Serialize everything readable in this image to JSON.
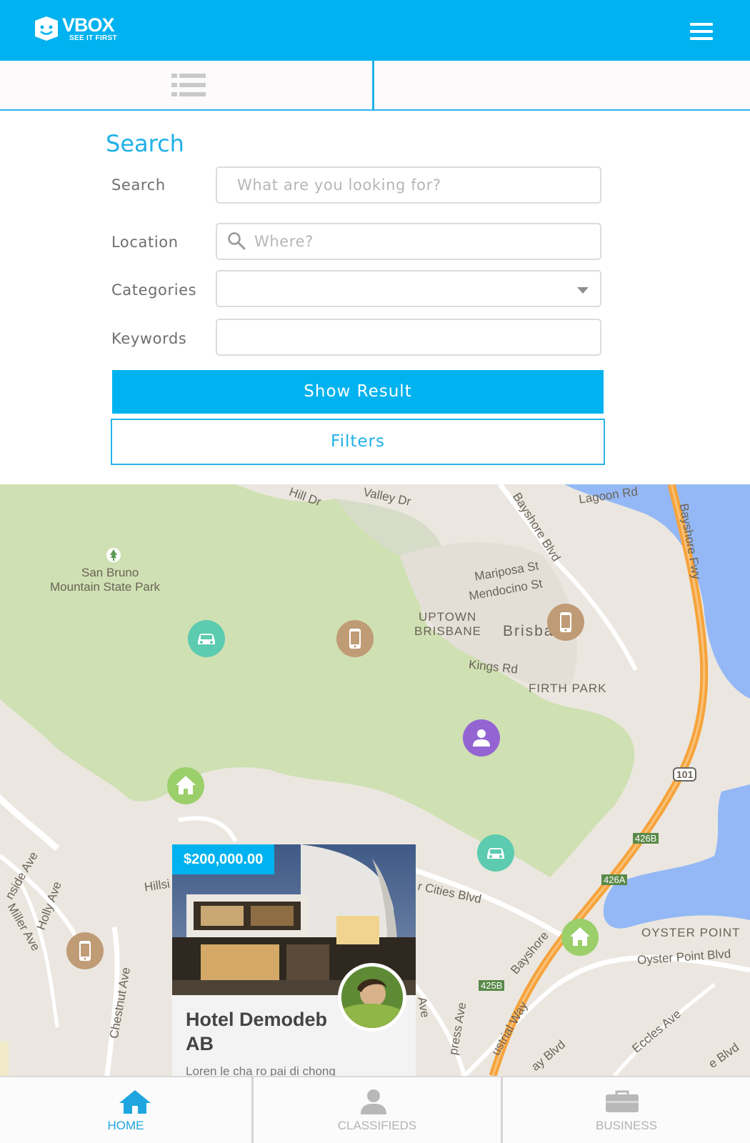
{
  "header": {
    "logo_word": "VBOX",
    "logo_tagline": "SEE IT FIRST",
    "menu_icon": "hamburger-menu-icon"
  },
  "view_tabs": {
    "list_icon": "list-view-icon",
    "map_icon": "map-pin-icon",
    "active": "map"
  },
  "search": {
    "title": "Search",
    "fields": {
      "search": {
        "label": "Search",
        "placeholder": "What are you looking for?",
        "value": ""
      },
      "location": {
        "label": "Location",
        "placeholder": "Where?",
        "value": ""
      },
      "categories": {
        "label": "Categories",
        "value": ""
      },
      "keywords": {
        "label": "Keywords",
        "value": ""
      }
    },
    "show_result_label": "Show Result",
    "filters_label": "Filters"
  },
  "map": {
    "labels": {
      "hill_dr": "Hill Dr",
      "valley_dr": "Valley Dr",
      "lagoon_rd": "Lagoon Rd",
      "bayshore_blvd": "Bayshore Blvd",
      "bayshore_fwy": "Bayshore Fwy",
      "park_line1": "San Bruno",
      "park_line2": "Mountain State Park",
      "mariposa": "Mariposa St",
      "mendocino": "Mendocino St",
      "uptown1": "UPTOWN",
      "uptown2": "BRISBANE",
      "brisbane": "Brisbane",
      "kings": "Kings Rd",
      "firth": "FIRTH PARK",
      "hwy101": "101",
      "exit426b": "426B",
      "exit426a": "426A",
      "exit425b": "425B",
      "sister_cities": "r Cities Blvd",
      "oyster_point": "OYSTER POINT",
      "oyster_blvd": "Oyster Point Blvd",
      "eccles": "Eccles Ave",
      "bayshore_lower": "Bayshore",
      "hillside_blvd": "Hillsi",
      "chestnut": "Chestnut Ave",
      "holly": "Holly Ave",
      "miller": "Miller Ave",
      "hillside_ave": "nside Ave",
      "industrial": "ustrial Way",
      "gateway": "ay Blvd",
      "express": "press Ave",
      "blvd_lr": "e Blvd",
      "ave_mid": "Ave"
    },
    "pins": [
      {
        "name": "car-pin",
        "icon": "car-icon",
        "color": "#5ccbb0"
      },
      {
        "name": "phone-pin",
        "icon": "phone-icon",
        "color": "#bf9b76"
      },
      {
        "name": "phone-pin",
        "icon": "phone-icon",
        "color": "#bf9b76"
      },
      {
        "name": "user-pin",
        "icon": "user-icon",
        "color": "#9364d2"
      },
      {
        "name": "home-pin",
        "icon": "home-icon",
        "color": "#9bcf6a"
      },
      {
        "name": "car-pin",
        "icon": "car-icon",
        "color": "#5ccbb0"
      },
      {
        "name": "home-pin",
        "icon": "home-icon",
        "color": "#9bcf6a"
      },
      {
        "name": "phone-pin",
        "icon": "phone-icon",
        "color": "#bf9b76"
      }
    ]
  },
  "listing_card": {
    "price": "$200,000.00",
    "title": "Hotel Demodeb AB",
    "description": "Loren le cha ro pai di chong"
  },
  "bottom_nav": {
    "items": [
      {
        "label": "HOME",
        "icon": "home-icon",
        "active": true
      },
      {
        "label": "CLASSIFIEDS",
        "icon": "person-icon",
        "active": false
      },
      {
        "label": "BUSINESS",
        "icon": "briefcase-icon",
        "active": false
      }
    ]
  },
  "colors": {
    "accent": "#00b2ef",
    "accent_text": "#1fb0e8",
    "map_land": "#ebe7e0",
    "map_park": "#cfe0b2",
    "map_water": "#94b8f5",
    "freeway": "#f6a33b"
  }
}
